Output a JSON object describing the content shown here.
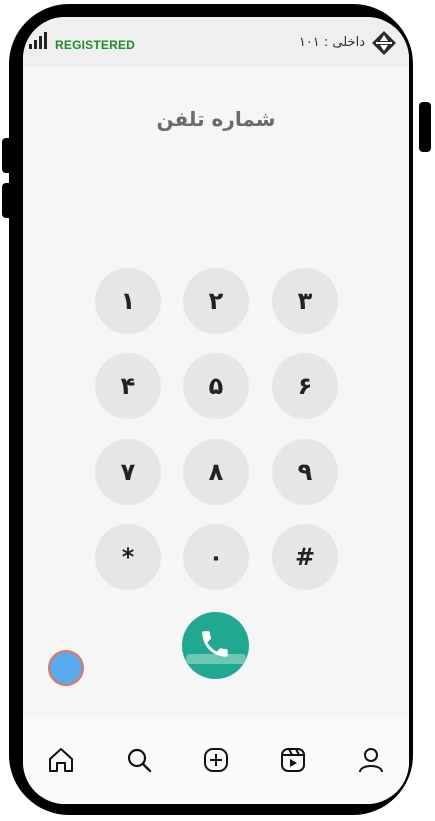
{
  "status_bar": {
    "registration_status": "REGISTERED",
    "extension": "داخلی : ۱۰۱",
    "registered_color": "#1d8f2a",
    "logo_icon": "app-logo-icon",
    "signal_icon": "signal-bars-icon"
  },
  "dialer": {
    "title": "شماره تلفن",
    "keys": [
      "۱",
      "۲",
      "۳",
      "۴",
      "۵",
      "۶",
      "۷",
      "۸",
      "۹",
      "*",
      "۰",
      "#"
    ],
    "call_icon": "phone-icon",
    "call_color": "#20a890"
  },
  "floating_button": {
    "color": "#5aaaf0",
    "border_color": "#f07050"
  },
  "bottom_nav": {
    "items": [
      {
        "icon": "home-icon"
      },
      {
        "icon": "search-icon"
      },
      {
        "icon": "add-circle-icon"
      },
      {
        "icon": "reels-icon"
      },
      {
        "icon": "profile-icon"
      }
    ]
  }
}
